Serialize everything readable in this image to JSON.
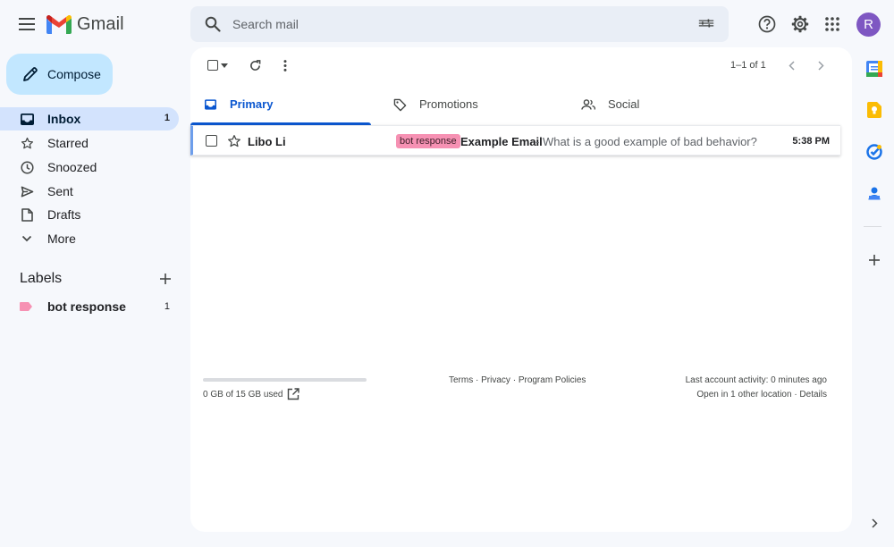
{
  "app": {
    "name": "Gmail"
  },
  "search": {
    "placeholder": "Search mail"
  },
  "user": {
    "initial": "R",
    "avatar_color": "#7e57c2"
  },
  "compose": {
    "label": "Compose"
  },
  "nav": [
    {
      "label": "Inbox",
      "count": "1",
      "icon": "inbox-icon",
      "active": true
    },
    {
      "label": "Starred",
      "count": "",
      "icon": "star-icon"
    },
    {
      "label": "Snoozed",
      "count": "",
      "icon": "clock-icon"
    },
    {
      "label": "Sent",
      "count": "",
      "icon": "send-icon"
    },
    {
      "label": "Drafts",
      "count": "",
      "icon": "draft-icon"
    },
    {
      "label": "More",
      "count": "",
      "icon": "chevron-down-icon"
    }
  ],
  "labels": {
    "heading": "Labels",
    "items": [
      {
        "name": "bot response",
        "count": "1",
        "color": "#f691b3"
      }
    ]
  },
  "toolbar": {
    "pagination": "1–1 of 1"
  },
  "tabs": [
    {
      "label": "Primary",
      "icon": "inbox-icon",
      "active": true
    },
    {
      "label": "Promotions",
      "icon": "tag-icon"
    },
    {
      "label": "Social",
      "icon": "people-icon"
    }
  ],
  "emails": [
    {
      "sender": "Libo Li",
      "label": "bot response",
      "subject": "Example Email",
      "snippet": "- What is a good example of bad behavior?",
      "time": "5:38 PM"
    }
  ],
  "footer": {
    "storage": "0 GB of 15 GB used",
    "storage_fraction": 0,
    "links": [
      "Terms",
      "Privacy",
      "Program Policies"
    ],
    "separator": " · ",
    "activity": "Last account activity: 0 minutes ago",
    "activity_detail": "Open in 1 other location · Details"
  },
  "colors": {
    "accent": "#0b57d0",
    "compose_bg": "#c2e7ff",
    "active_nav_bg": "#d3e3fd",
    "label_chip": "#f691b3"
  }
}
